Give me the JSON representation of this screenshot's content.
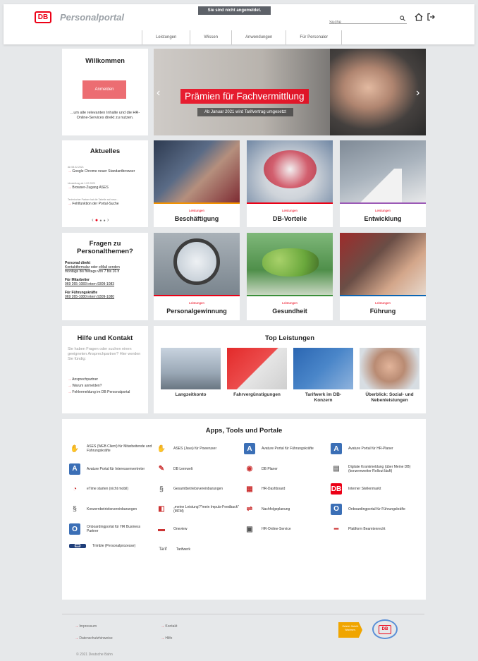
{
  "header": {
    "logo": "DB",
    "title": "Personalportal",
    "login_status": "Sie sind nicht angemeldet.",
    "search_placeholder": "Suche"
  },
  "nav": [
    "Leistungen",
    "Wissen",
    "Anwendungen",
    "Für Personaler"
  ],
  "welcome": {
    "title": "Willkommen",
    "button": "Anmelden",
    "text": "...um alle relevanten Inhalte und die HR-Online-Services direkt zu nutzen."
  },
  "hero": {
    "title": "Prämien für Fachvermittlung",
    "subtitle": "Ab Januar 2021 wird Tarifvertrag umgesetzt"
  },
  "news": {
    "title": "Aktuelles",
    "items": [
      {
        "date": "Ab 08.02.2021",
        "text": "Google Chrome neuer Standardbrowser"
      },
      {
        "date": "Umstellung ab 1.02.2020",
        "text": "Browser-Zugang ASES"
      },
      {
        "date": "Technischer Partner hat die Tabelle auf neue...",
        "text": "Fehlfunktion der Portal-Suche"
      }
    ]
  },
  "tiles": [
    {
      "cat": "Leistungen",
      "name": "Beschäftigung",
      "stripe": "#f39200",
      "bg": "#8a6f63"
    },
    {
      "cat": "Leistungen",
      "name": "DB-Vorteile",
      "stripe": "#ec0016",
      "bg": "#c9ccd3"
    },
    {
      "cat": "Leistungen",
      "name": "Entwicklung",
      "stripe": "#9b59b6",
      "bg": "#b9c2cc"
    },
    {
      "cat": "Leistungen",
      "name": "Personalgewinnung",
      "stripe": "#ec0016",
      "bg": "#9aa4ad"
    },
    {
      "cat": "Leistungen",
      "name": "Gesundheit",
      "stripe": "#3a8f3a",
      "bg": "#8fbf7a"
    },
    {
      "cat": "Leistungen",
      "name": "Führung",
      "stripe": "#0c66b4",
      "bg": "#7d5a50"
    }
  ],
  "questions": {
    "title": "Fragen zu Personalthemen?",
    "s1_title": "Personal direkt",
    "s1_link1": "Kontaktformular",
    "s1_or": "oder",
    "s1_link2": "eMail senden",
    "s1_hours": "montags bis freitags von 7 bis 16 h",
    "s2_title": "Für Mitarbeiter",
    "s2_phone": "069 265-1083 intern 9309-1083",
    "s3_title": "Für Führungskräfte",
    "s3_phone": "069 265-1080 intern 9309-1080"
  },
  "help": {
    "title": "Hilfe und Kontakt",
    "text": "Sie haben Fragen oder suchen einen geeigneten Ansprechpartner? Hier werden Sie fündig:",
    "links": [
      "Ansprechpartner",
      "Warum anmelden?",
      "Fehlermeldung im DB Personalportal"
    ]
  },
  "top": {
    "title": "Top Leistungen",
    "items": [
      {
        "name": "Langzeitkonto"
      },
      {
        "name": "Fahrvergünstigungen"
      },
      {
        "name": "Tarifwerk im DB-Konzern"
      },
      {
        "name": "Überblick: Sozial- und Nebenleistungen"
      }
    ]
  },
  "apps": {
    "title": "Apps, Tools und Portale",
    "items": [
      {
        "label": "ASES (WEB Client) für Mitarbeitende und Führungskräfte",
        "icon": "✋",
        "color": "#333"
      },
      {
        "label": "ASES (Java) für Poweruser",
        "icon": "✋",
        "color": "#333"
      },
      {
        "label": "Avature Portal für Führungskräfte",
        "icon": "A",
        "color": "#3b6fb6"
      },
      {
        "label": "Avature Portal für HR-Planer",
        "icon": "A",
        "color": "#3b6fb6"
      },
      {
        "label": "Avature Portal für Interessenvertreter",
        "icon": "A",
        "color": "#3b6fb6"
      },
      {
        "label": "DB Lernwelt",
        "icon": "✎",
        "color": "#c33"
      },
      {
        "label": "DB Planer",
        "icon": "◉",
        "color": "#c33"
      },
      {
        "label": "Digitale Krankmeldung (über Meine DB) (konzernweiter Rollout läuft)",
        "icon": "▤",
        "color": "#777"
      },
      {
        "label": "eTime starten (nicht mobil)",
        "icon": "◔",
        "color": "#c33"
      },
      {
        "label": "Gesamtbetriebsvereinbarungen",
        "icon": "§",
        "color": "#777"
      },
      {
        "label": "HR-Dashboard",
        "icon": "▦",
        "color": "#c33"
      },
      {
        "label": "Interner Stellenmarkt",
        "icon": "DB",
        "color": "#ec0016"
      },
      {
        "label": "Konzernbetriebsvereinbarungen",
        "icon": "§",
        "color": "#777"
      },
      {
        "label": "„meine Leistung\"/\"mein Impuls-Feedback\" (MFM)",
        "icon": "◧",
        "color": "#c33"
      },
      {
        "label": "Nachfolgeplanung",
        "icon": "⇌",
        "color": "#c33"
      },
      {
        "label": "Onboardingportal für Führungskräfte",
        "icon": "O",
        "color": "#3b6fb6"
      },
      {
        "label": "Onboardingportal für HR Business Partner",
        "icon": "O",
        "color": "#3b6fb6"
      },
      {
        "label": "Oneview",
        "icon": "▬",
        "color": "#c33"
      },
      {
        "label": "HR-Online-Service",
        "icon": "▣",
        "color": "#555"
      },
      {
        "label": "Plattform Beamtenrecht",
        "icon": "━",
        "color": "#c33"
      },
      {
        "label": "Trimble (Personalprozesse)",
        "icon": "▭",
        "color": "#1f3e7a"
      },
      {
        "label": "Tarifwerk",
        "icon": "Tarif",
        "color": "#fff"
      }
    ]
  },
  "footer": {
    "links_left": [
      "Impressum",
      "Datenschutzhinweise"
    ],
    "links_right": [
      "Kontakt",
      "Hilfe"
    ],
    "badge": "Gelebt. Geteilt. Wachsen.",
    "copyright": "© 2021 Deutsche Bahn"
  }
}
